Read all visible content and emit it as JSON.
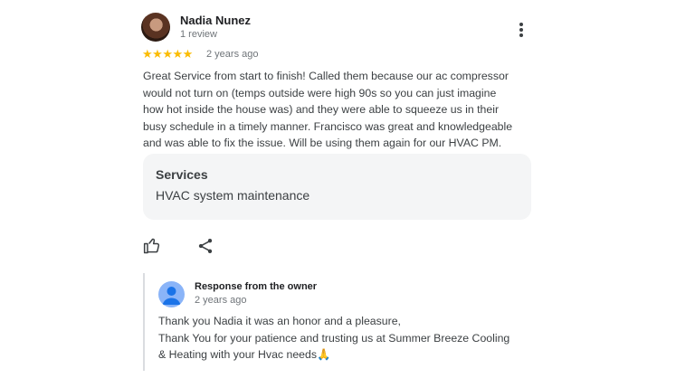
{
  "reviewer": {
    "name": "Nadia Nunez",
    "review_count": "1 review",
    "rating": 5,
    "date": "2 years ago"
  },
  "review": {
    "lines": [
      "Great Service from start to finish! Called them because our ac compressor",
      "would not turn on (temps outside were high 90s so you can just imagine",
      "how hot inside the house was) and they were able to squeeze us in their",
      "busy schedule in a timely manner. Francisco was great and knowledgeable",
      "and was able to fix the issue. Will be using them again for our HVAC PM."
    ]
  },
  "services": {
    "title": "Services",
    "value": "HVAC system maintenance"
  },
  "owner_response": {
    "title": "Response from the owner",
    "date": "2 years ago",
    "lines": [
      "Thank you Nadia it was an honor and a pleasure,",
      "Thank You for your patience and trusting us at Summer Breeze Cooling",
      "& Heating with your Hvac needs"
    ],
    "emoji": "🙏"
  },
  "icons": {
    "star": "★",
    "more": "more-vert-icon",
    "like": "thumbs-up-icon",
    "share": "share-icon"
  },
  "colors": {
    "star": "#fbbc04",
    "owner_avatar": "#8ab4f8"
  }
}
